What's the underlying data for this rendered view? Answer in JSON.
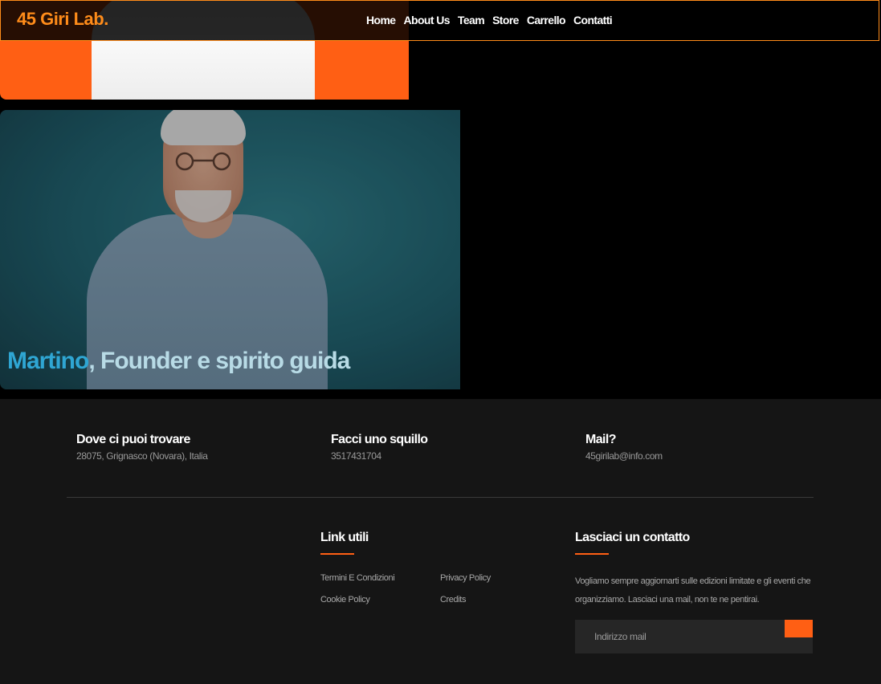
{
  "brand": {
    "name": "45 Giri Lab.",
    "accent": "#ff8c1a"
  },
  "nav": {
    "items": [
      {
        "label": "Home"
      },
      {
        "label": "About Us"
      },
      {
        "label": "Team"
      },
      {
        "label": "Store"
      },
      {
        "label": "Carrello"
      },
      {
        "label": "Contatti"
      }
    ]
  },
  "team": {
    "featured": {
      "name": "Martino",
      "role": ", Founder e spirito guida"
    }
  },
  "footer": {
    "info": [
      {
        "title": "Dove ci puoi trovare",
        "text": "28075, Grignasco (Novara), Italia"
      },
      {
        "title": "Facci uno squillo",
        "text": "3517431704"
      },
      {
        "title": "Mail?",
        "text": "45girilab@info.com"
      }
    ],
    "links": {
      "title": "Link utili",
      "items": [
        {
          "label": "Termini E Condizioni"
        },
        {
          "label": "Privacy Policy"
        },
        {
          "label": "Cookie Policy"
        },
        {
          "label": "Credits"
        }
      ]
    },
    "contact": {
      "title": "Lasciaci un contatto",
      "text": "Vogliamo sempre aggiornarti sulle edizioni limitate e gli eventi che organizziamo. Lasciaci una mail, non te ne pentirai.",
      "placeholder": "Indirizzo mail",
      "button_color": "#ff5f14"
    }
  }
}
